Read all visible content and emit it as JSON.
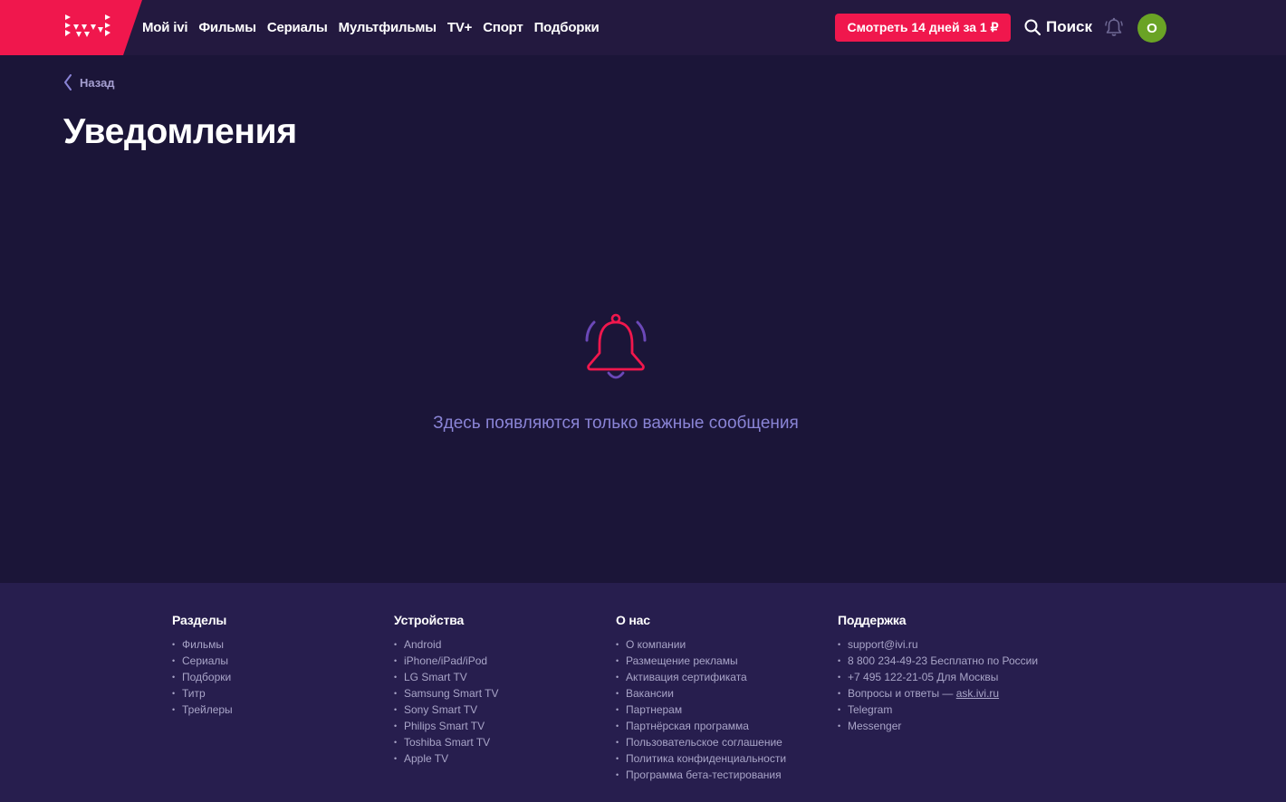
{
  "brand": {
    "logo_text": "ivi",
    "accent_color": "#f0174d",
    "background_color": "#1b1538",
    "header_color": "#23193f",
    "footer_color": "#271e4e"
  },
  "nav": {
    "items": [
      "Мой ivi",
      "Фильмы",
      "Сериалы",
      "Мультфильмы",
      "TV+",
      "Спорт",
      "Подборки"
    ]
  },
  "header": {
    "subscribe_label": "Смотреть 14 дней за 1 ₽",
    "search_label": "Поиск",
    "search_icon": "search-icon",
    "bell_icon": "bell-icon",
    "avatar_letter": "О",
    "avatar_color": "#6aa325"
  },
  "back": {
    "label": "Назад",
    "icon": "chevron-left-icon"
  },
  "page": {
    "title": "Уведомления",
    "empty_icon": "bell-icon",
    "empty_message": "Здесь появляются только важные сообщения"
  },
  "footer": {
    "sections": {
      "title": "Разделы",
      "items": [
        "Фильмы",
        "Сериалы",
        "Подборки",
        "Титр",
        "Трейлеры"
      ]
    },
    "devices": {
      "title": "Устройства",
      "items": [
        "Android",
        "iPhone/iPad/iPod",
        "LG Smart TV",
        "Samsung Smart TV",
        "Sony Smart TV",
        "Philips Smart TV",
        "Toshiba Smart TV",
        "Apple TV"
      ]
    },
    "about": {
      "title": "О нас",
      "items": [
        "О компании",
        "Размещение рекламы",
        "Активация сертификата",
        "Вакансии",
        "Партнерам",
        "Партнёрская программа",
        "Пользовательское соглашение",
        "Политика конфиденциальности",
        "Программа бета-тестирования"
      ]
    },
    "support": {
      "title": "Поддержка",
      "email": "support@ivi.ru",
      "phone_free": "8 800 234-49-23 Бесплатно по России",
      "phone_moscow": "+7 495 122-21-05 Для Москвы",
      "faq_prefix": "Вопросы и ответы — ",
      "faq_link": "ask.ivi.ru",
      "telegram": "Telegram",
      "messenger": "Messenger"
    }
  }
}
